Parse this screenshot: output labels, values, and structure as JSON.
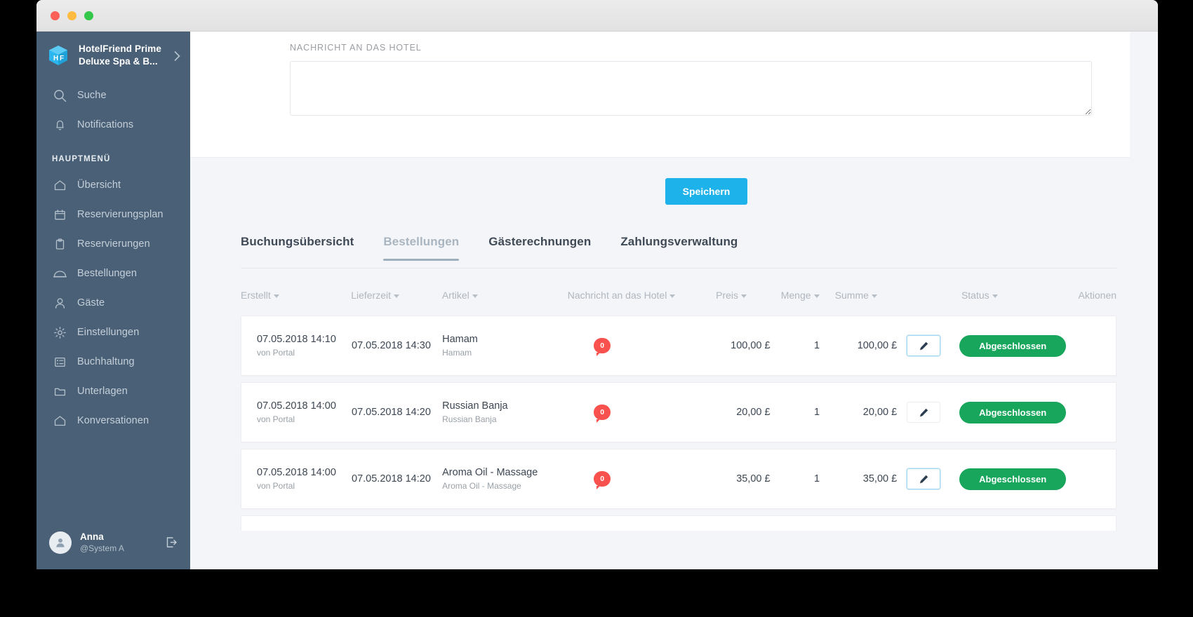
{
  "window": {
    "traffic_lights": [
      "close",
      "minimize",
      "maximize"
    ]
  },
  "sidebar": {
    "brand": {
      "name": "HotelFriend Prime",
      "subtitle": "Deluxe Spa & B...",
      "logo_icon": "hotelfriend-cube-logo",
      "chevron_icon": "chevron-right-icon"
    },
    "quick_items": [
      {
        "label": "Suche",
        "icon": "search-icon"
      },
      {
        "label": "Notifications",
        "icon": "bell-icon"
      }
    ],
    "section_title": "HAUPTMENÜ",
    "items": [
      {
        "label": "Übersicht",
        "icon": "home-icon"
      },
      {
        "label": "Reservierungsplan",
        "icon": "calendar-icon"
      },
      {
        "label": "Reservierungen",
        "icon": "clipboard-icon"
      },
      {
        "label": "Bestellungen",
        "icon": "room-service-icon"
      },
      {
        "label": "Gäste",
        "icon": "user-icon"
      },
      {
        "label": "Einstellungen",
        "icon": "gear-icon"
      },
      {
        "label": "Buchhaltung",
        "icon": "list-icon"
      },
      {
        "label": "Unterlagen",
        "icon": "folder-icon"
      },
      {
        "label": "Konversationen",
        "icon": "home-icon"
      }
    ],
    "user": {
      "name": "Anna",
      "handle": "@System A",
      "avatar_icon": "avatar-icon",
      "logout_icon": "logout-icon"
    },
    "bg_color": "#4a6076"
  },
  "main": {
    "message_panel": {
      "label": "NACHRICHT AN DAS HOTEL",
      "value": "",
      "placeholder": ""
    },
    "save_button": {
      "label": "Speichern",
      "color": "#1eb2ea"
    },
    "tabs": [
      {
        "label": "Buchungsübersicht",
        "active": false
      },
      {
        "label": "Bestellungen",
        "active": true
      },
      {
        "label": "Gästerechnungen",
        "active": false
      },
      {
        "label": "Zahlungsverwaltung",
        "active": false
      }
    ],
    "table": {
      "columns": [
        {
          "label": "Erstellt",
          "sortable": true
        },
        {
          "label": "Lieferzeit",
          "sortable": true
        },
        {
          "label": "Artikel",
          "sortable": true
        },
        {
          "label": "Nachricht an das Hotel",
          "sortable": true
        },
        {
          "label": "Preis",
          "sortable": true
        },
        {
          "label": "Menge",
          "sortable": true
        },
        {
          "label": "Summe",
          "sortable": true
        },
        {
          "label": "Status",
          "sortable": true
        },
        {
          "label": "Aktionen",
          "sortable": false
        }
      ],
      "rows": [
        {
          "erstellt": "07.05.2018 14:10",
          "erstellt_sub": "von Portal",
          "lieferzeit": "07.05.2018 14:30",
          "artikel": "Hamam",
          "artikel_sub": "Hamam",
          "nachricht_count": "0",
          "preis": "100,00 £",
          "menge": "1",
          "summe": "100,00 £",
          "edit_icon": "pencil-icon",
          "edit_focused": true,
          "status": "Abgeschlossen",
          "status_color": "#17a65b"
        },
        {
          "erstellt": "07.05.2018 14:00",
          "erstellt_sub": "von Portal",
          "lieferzeit": "07.05.2018 14:20",
          "artikel": "Russian Banja",
          "artikel_sub": "Russian Banja",
          "nachricht_count": "0",
          "preis": "20,00 £",
          "menge": "1",
          "summe": "20,00 £",
          "edit_icon": "pencil-icon",
          "edit_focused": false,
          "status": "Abgeschlossen",
          "status_color": "#17a65b"
        },
        {
          "erstellt": "07.05.2018 14:00",
          "erstellt_sub": "von Portal",
          "lieferzeit": "07.05.2018 14:20",
          "artikel": "Aroma Oil - Massage",
          "artikel_sub": "Aroma Oil - Massage",
          "nachricht_count": "0",
          "preis": "35,00 £",
          "menge": "1",
          "summe": "35,00 £",
          "edit_icon": "pencil-icon",
          "edit_focused": true,
          "status": "Abgeschlossen",
          "status_color": "#17a65b"
        }
      ]
    }
  }
}
